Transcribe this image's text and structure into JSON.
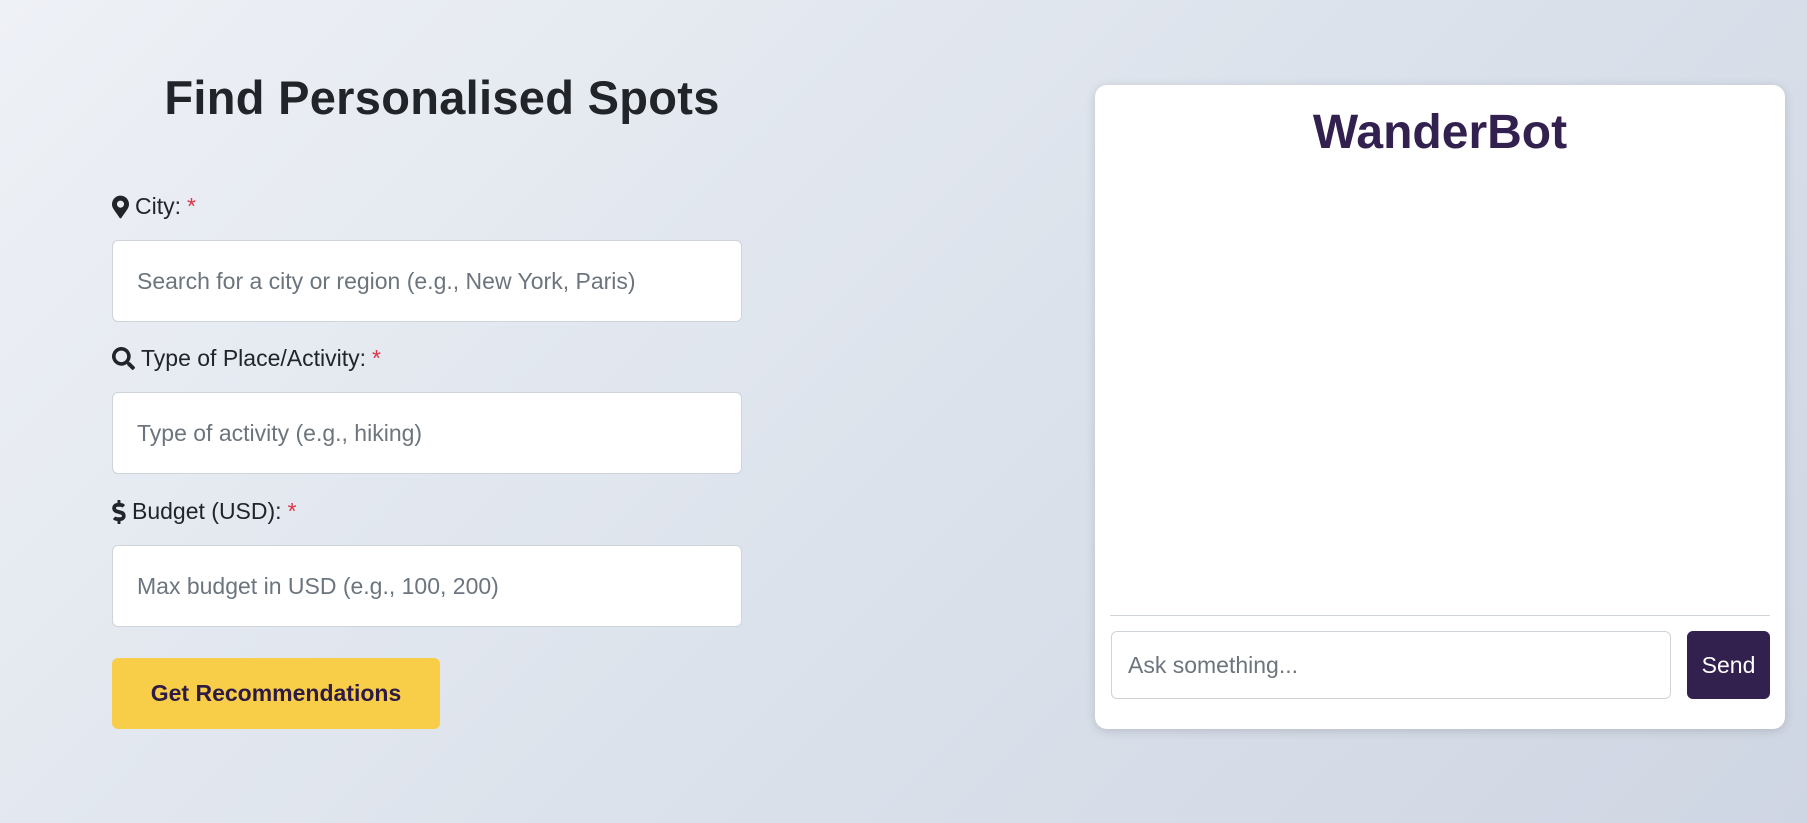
{
  "form": {
    "title": "Find Personalised Spots",
    "city": {
      "icon": "map-marker-icon",
      "label": "City:",
      "required_mark": "*",
      "placeholder": "Search for a city or region (e.g., New York, Paris)",
      "value": ""
    },
    "activity": {
      "icon": "search-icon",
      "label": "Type of Place/Activity:",
      "required_mark": "*",
      "placeholder": "Type of activity (e.g., hiking)",
      "value": ""
    },
    "budget": {
      "icon": "dollar-icon",
      "label": "Budget (USD):",
      "required_mark": "*",
      "placeholder": "Max budget in USD (e.g., 100, 200)",
      "value": ""
    },
    "submit_label": "Get Recommendations"
  },
  "chat": {
    "title": "WanderBot",
    "messages": [],
    "input_placeholder": "Ask something...",
    "input_value": "",
    "send_label": "Send"
  },
  "colors": {
    "accent_button": "#f8cd47",
    "brand_purple": "#32204f",
    "required": "#dc3545"
  }
}
